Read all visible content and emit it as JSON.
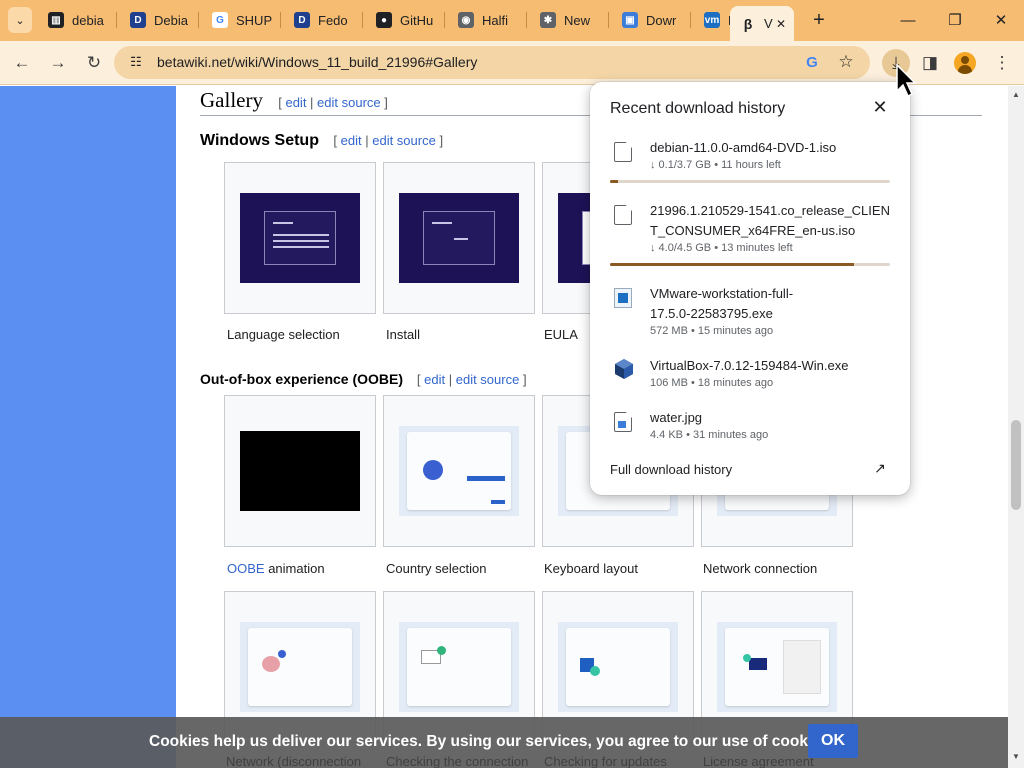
{
  "browser": {
    "tabs": [
      {
        "title": "debia",
        "icon": "library-icon",
        "fav_text": "▥",
        "fav_bg": "#202124",
        "fav_color": "#ffffff"
      },
      {
        "title": "Debia",
        "icon": "d-icon",
        "fav_text": "D",
        "fav_bg": "#1f3f8f",
        "fav_color": "#ffffff"
      },
      {
        "title": "SHUP",
        "icon": "google-icon",
        "fav_text": "G",
        "fav_bg": "#ffffff",
        "fav_color": "#4285f4"
      },
      {
        "title": "Fedo",
        "icon": "d-icon",
        "fav_text": "D",
        "fav_bg": "#1f3f8f",
        "fav_color": "#ffffff"
      },
      {
        "title": "GitHu",
        "icon": "github-icon",
        "fav_text": "●",
        "fav_bg": "#202124",
        "fav_color": "#ffffff"
      },
      {
        "title": "Halfi",
        "icon": "halfi-icon",
        "fav_text": "◉",
        "fav_bg": "#5f6368",
        "fav_color": "#ffffff"
      },
      {
        "title": "New",
        "icon": "gear-icon",
        "fav_text": "✱",
        "fav_bg": "#5f6368",
        "fav_color": "#ffffff"
      },
      {
        "title": "Dowr",
        "icon": "image-icon",
        "fav_text": "▣",
        "fav_bg": "#3b7dd8",
        "fav_color": "#ffffff"
      },
      {
        "title": "Dowr",
        "icon": "vmware-icon",
        "fav_text": "vm",
        "fav_bg": "#1d6fc2",
        "fav_color": "#ffffff"
      }
    ],
    "active_tab": {
      "title": "V",
      "icon": "betawiki-icon",
      "fav_text": "β"
    },
    "url": "betawiki.net/wiki/Windows_11_build_21996#Gallery"
  },
  "page": {
    "gallery_heading": "Gallery",
    "gallery_edit": "edit",
    "gallery_edit_source": "edit source",
    "setup_heading": "Windows Setup",
    "setup_edit": "edit",
    "setup_edit_source": "edit source",
    "setup_captions": [
      "Language selection",
      "Install",
      "EULA"
    ],
    "oobe_heading": "Out-of-box experience (OOBE)",
    "oobe_edit": "edit",
    "oobe_edit_source": "edit source",
    "oobe_first_link": "OOBE",
    "oobe_first_rest": " animation",
    "oobe_captions": [
      "Country selection",
      "Keyboard layout",
      "Network connection"
    ],
    "row3_captions": [
      "Network (disconnection",
      "Checking the connection",
      "Checking for updates",
      "License agreement"
    ]
  },
  "cookie": {
    "text": "Cookies help us deliver our services. By using our services, you agree to our use of cookies.",
    "ok": "OK"
  },
  "downloads": {
    "title": "Recent download history",
    "items": [
      {
        "name": "debian-11.0.0-amd64-DVD-1.iso",
        "status": "↓ 0.1/3.7 GB • 11 hours left",
        "progress": 0.03,
        "icon": "file-icon"
      },
      {
        "name": "21996.1.210529-1541.co_release_CLIENT_CONSUMER_x64FRE_en-us.iso",
        "status": "↓ 4.0/4.5 GB • 13 minutes left",
        "progress": 0.87,
        "icon": "file-icon"
      },
      {
        "name": "VMware-workstation-full-17.5.0-22583795.exe",
        "status": "572 MB • 15 minutes ago",
        "icon": "vmware-installer-icon"
      },
      {
        "name": "VirtualBox-7.0.12-159484-Win.exe",
        "status": "106 MB • 18 minutes ago",
        "icon": "virtualbox-icon"
      },
      {
        "name": "water.jpg",
        "status": "4.4 KB • 31 minutes ago",
        "icon": "image-file-icon"
      }
    ],
    "full_history": "Full download history"
  }
}
